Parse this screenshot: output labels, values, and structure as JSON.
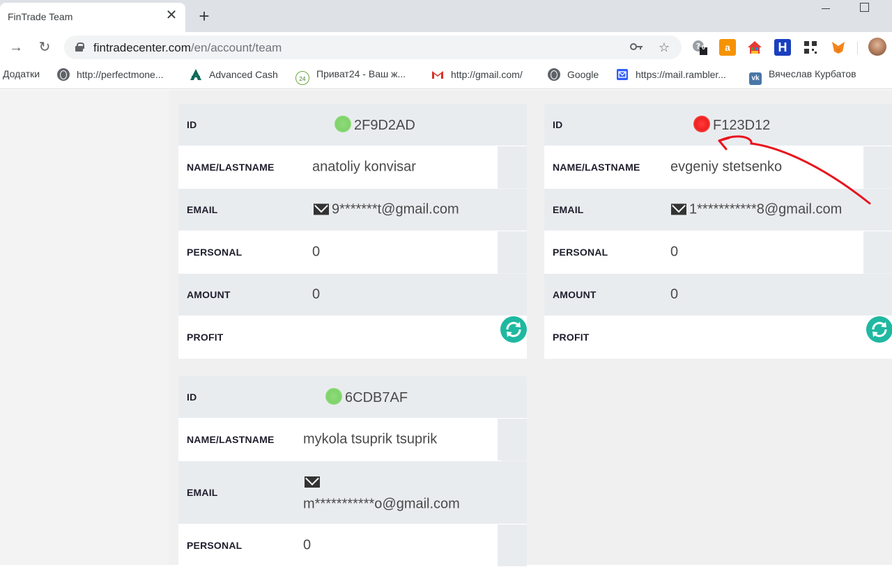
{
  "browser": {
    "tab_title": "FinTrade Team",
    "tab_close": "✕",
    "new_tab": "+",
    "url_host": "fintradecenter.com",
    "url_path": "/en/account/team",
    "bookmarks": [
      {
        "label": "Додатки",
        "icon": "apps-icon"
      },
      {
        "label": "http://perfectmone...",
        "icon": "globe-icon"
      },
      {
        "label": "Advanced Cash",
        "icon": "advcash-icon"
      },
      {
        "label": "Приват24 - Ваш ж...",
        "icon": "privat24-icon"
      },
      {
        "label": "http://gmail.com/",
        "icon": "gmail-icon"
      },
      {
        "label": "Google",
        "icon": "globe-icon"
      },
      {
        "label": "https://mail.rambler...",
        "icon": "rambler-icon"
      },
      {
        "label": "Вячеслав Курбатов",
        "icon": "vk-icon"
      }
    ],
    "extensions": {
      "badge_count": "0",
      "privat_badge": "24"
    }
  },
  "labels": {
    "id": "ID",
    "name": "NAME/LASTNAME",
    "email": "EMAIL",
    "personal": "PERSONAL",
    "amount": "AMOUNT",
    "profit": "PROFIT"
  },
  "members": [
    {
      "id": "2F9D2AD",
      "status": "green",
      "name": "anatoliy konvisar",
      "email": "9*******t@gmail.com",
      "personal": "0",
      "amount": "0",
      "profit": ""
    },
    {
      "id": "F123D12",
      "status": "red",
      "name": "evgeniy stetsenko",
      "email": "1***********8@gmail.com",
      "personal": "0",
      "amount": "0",
      "profit": ""
    },
    {
      "id": "6CDB7AF",
      "status": "green",
      "name": "mykola tsuprik tsuprik",
      "email": "m***********o@gmail.com",
      "personal": "0"
    }
  ],
  "colors": {
    "status_active": "#7fd36a",
    "status_inactive": "#f02020",
    "refresh_button": "#1fb8a0",
    "annotation_arrow": "#e8141c"
  }
}
